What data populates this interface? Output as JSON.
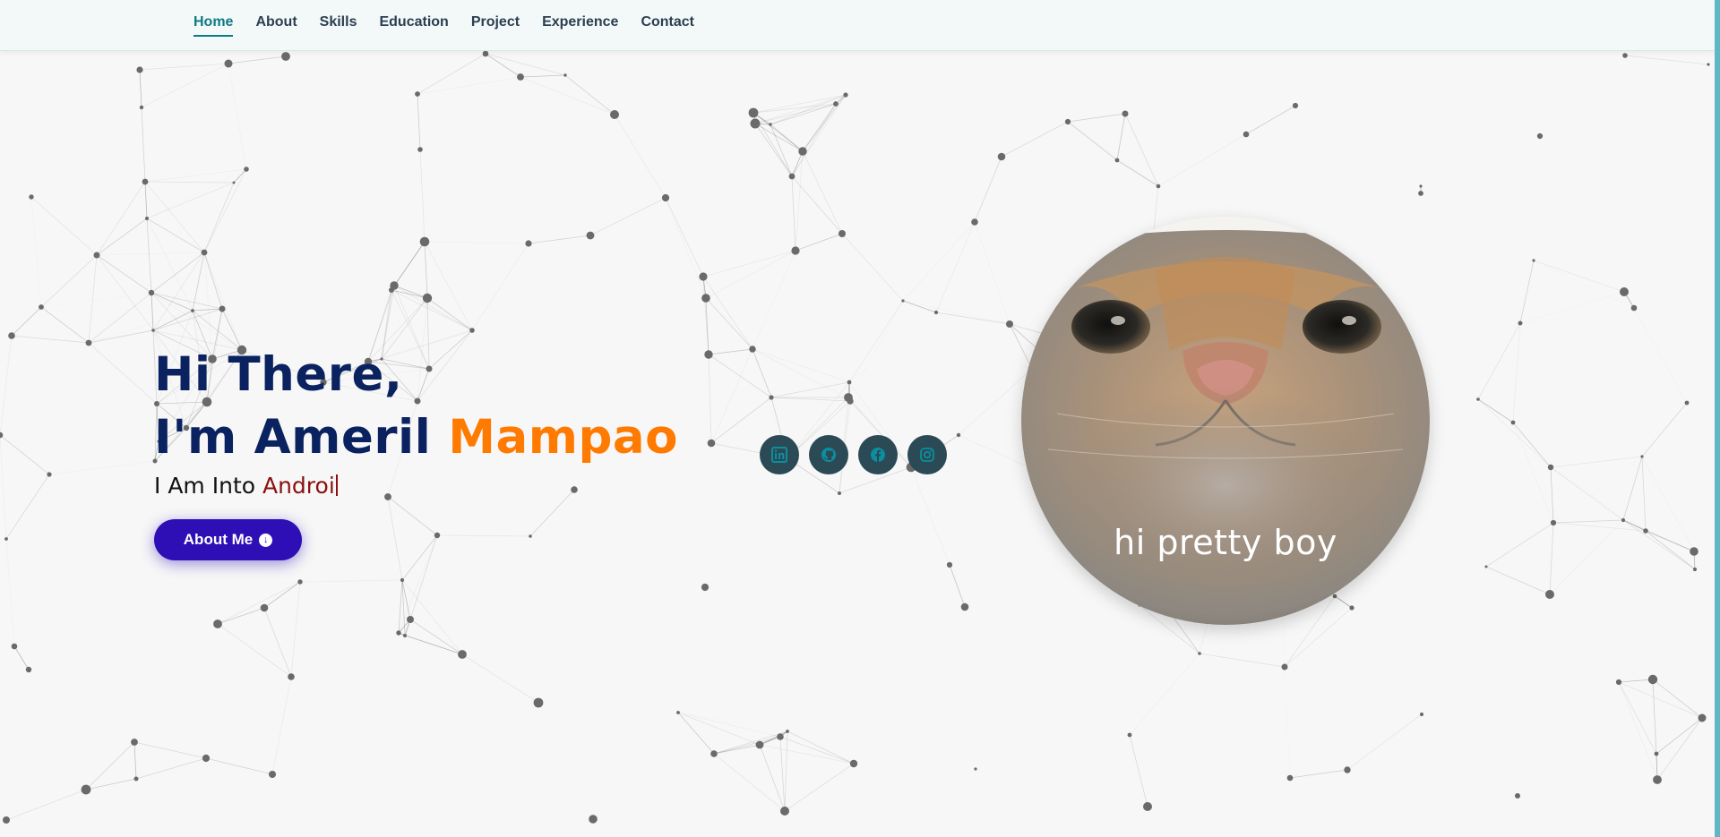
{
  "nav": {
    "items": [
      {
        "label": "Home",
        "active": true
      },
      {
        "label": "About"
      },
      {
        "label": "Skills"
      },
      {
        "label": "Education"
      },
      {
        "label": "Project"
      },
      {
        "label": "Experience"
      },
      {
        "label": "Contact"
      }
    ]
  },
  "hero": {
    "line1": "Hi There,",
    "line2_prefix": "I'm Ameril ",
    "line2_accent": "Mampao",
    "typing_prefix": "I Am Into ",
    "typing_value": "Androi",
    "about_button_label": "About Me"
  },
  "socials": {
    "icons": [
      "linkedin-icon",
      "github-icon",
      "facebook-icon",
      "instagram-icon"
    ]
  },
  "avatar": {
    "caption": "hi pretty boy"
  },
  "colors": {
    "heading": "#0b2260",
    "accent": "#ff7a00",
    "typed": "#8b0f0f",
    "button": "#2d0fb5",
    "nav_active": "#0e7a83",
    "social_bg": "#2c4a55",
    "social_icon": "#0a8fa0"
  }
}
